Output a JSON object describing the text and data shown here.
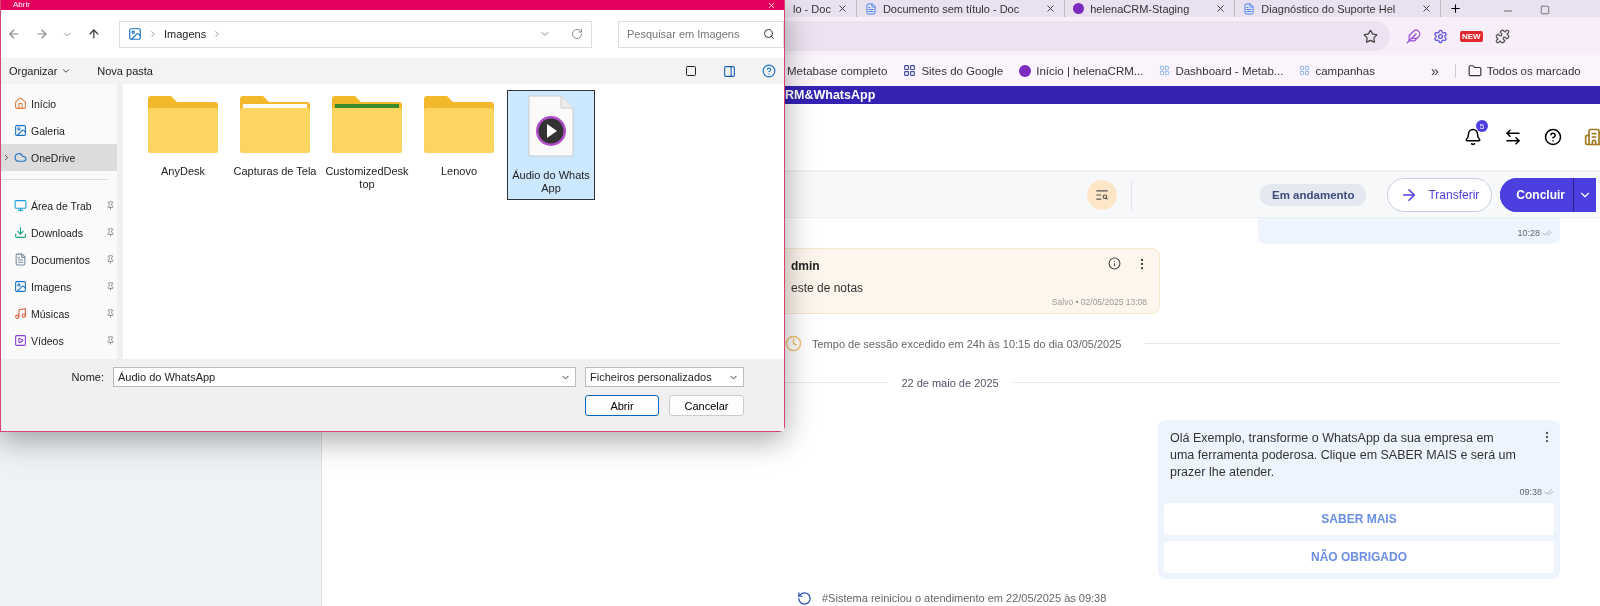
{
  "browser": {
    "tabs": [
      {
        "title": "lo - Doc"
      },
      {
        "title": "Documento sem título - Doc",
        "kind": "docs"
      },
      {
        "title": "helenaCRM-Staging",
        "kind": "helena"
      },
      {
        "title": "Diagnóstico do Suporte Hel",
        "kind": "docs"
      }
    ],
    "extension_badge": "NEW",
    "bookmarks": [
      {
        "label": "Metabase completo",
        "kind": "plain"
      },
      {
        "label": "Sites do Google",
        "kind": "sites"
      },
      {
        "label": "Início | helenaCRM...",
        "kind": "helena"
      },
      {
        "label": "Dashboard - Metab...",
        "kind": "metabase"
      },
      {
        "label": "campanhas",
        "kind": "metabase"
      }
    ],
    "more_bookmarks": "»",
    "all_bookmarks": "Todos os marcado"
  },
  "app": {
    "banner": "RM&WhatsApp",
    "notifications": "5",
    "toolbar": {
      "status": "Em andamento",
      "transfer": "Transferir",
      "conclude": "Concluir"
    },
    "chat": [
      {
        "kind": "outgoing",
        "time": "10:28"
      },
      {
        "kind": "note",
        "author": "dmin",
        "text": "este de notas",
        "saved": "Salvo • 02/05/2025 13:08"
      },
      {
        "kind": "session",
        "text": "Tempo de sessão excedido em 24h às 10:15 do dia 03/05/2025"
      },
      {
        "kind": "date",
        "text": "22 de maio de 2025"
      },
      {
        "kind": "outgoing",
        "text": "Olá Exemplo, transforme o WhatsApp da sua empresa em uma ferramenta poderosa. Clique em SABER MAIS e será um prazer lhe atender.",
        "time": "09:38",
        "buttons": [
          "SABER MAIS",
          "NÃO OBRIGADO"
        ]
      },
      {
        "kind": "system",
        "text": "#Sistema reiniciou o atendimento em 22/05/2025 às 09:38"
      }
    ]
  },
  "dialog": {
    "title": "Abrir",
    "path": "Imagens",
    "search_placeholder": "Pesquisar em Imagens",
    "organize": "Organizar",
    "new_folder": "Nova pasta",
    "nav": [
      {
        "label": "Início",
        "kind": "home",
        "selected": false,
        "pinned": false
      },
      {
        "label": "Galeria",
        "kind": "gallery",
        "selected": false,
        "pinned": false
      },
      {
        "label": "OneDrive",
        "kind": "cloud",
        "selected": true,
        "pinned": false
      },
      {
        "label": "Área de Trab",
        "kind": "desktop",
        "selected": false,
        "pinned": true
      },
      {
        "label": "Downloads",
        "kind": "downloads",
        "selected": false,
        "pinned": true
      },
      {
        "label": "Documentos",
        "kind": "documents",
        "selected": false,
        "pinned": true
      },
      {
        "label": "Imagens",
        "kind": "pictures",
        "selected": false,
        "pinned": true
      },
      {
        "label": "Músicas",
        "kind": "music",
        "selected": false,
        "pinned": true
      },
      {
        "label": "Vídeos",
        "kind": "videos",
        "selected": false,
        "pinned": true
      }
    ],
    "files": [
      {
        "name": "AnyDesk",
        "kind": "folder",
        "selected": false
      },
      {
        "name": "Capturas de Tela",
        "kind": "folder-screens",
        "selected": false
      },
      {
        "name": "CustomizedDesktop",
        "kind": "folder-photo",
        "selected": false
      },
      {
        "name": "Lenovo",
        "kind": "folder",
        "selected": false
      },
      {
        "name": "Áudio do WhatsApp",
        "kind": "audio",
        "selected": true
      }
    ],
    "name_label": "Nome:",
    "name_value": "Áudio do WhatsApp",
    "filter": "Ficheiros personalizados",
    "open": "Abrir",
    "cancel": "Cancelar"
  }
}
